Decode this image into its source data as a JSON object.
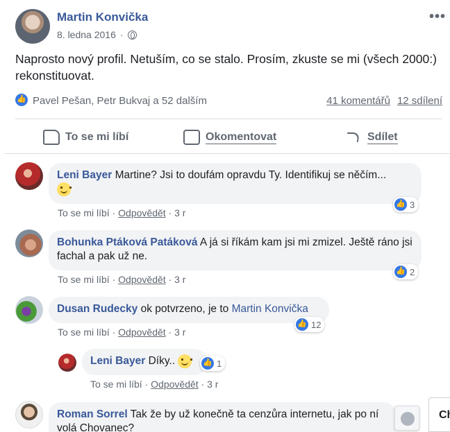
{
  "post": {
    "author": "Martin Konvička",
    "date": "8. ledna 2016",
    "date_separator": "·",
    "privacy_icon": "globe-icon",
    "more_icon": "•••",
    "text": "Naprosto nový profil. Netuším, co se stalo. Prosím, zkuste se mi (všech 2000:) rekonstituovat.",
    "likes_names": "Pavel Pešan, Petr Bukvaj a 52 dalším",
    "comments_count": "41 komentářů",
    "shares_count": "12 sdílení"
  },
  "actions": {
    "like": "To se mi líbí",
    "comment": "Okomentovat",
    "share": "Sdílet"
  },
  "comments": [
    {
      "name": "Leni Bayer",
      "text": "Martine? Jsi to doufám opravdu Ty. Identifikuj se něčím...",
      "like": "To se mi líbí",
      "reply": "Odpovědět",
      "time": "3 r",
      "reactions": "3"
    },
    {
      "name": "Bohunka Ptáková Patáková",
      "text": "A já si říkám kam jsi mi zmizel. Ještě ráno jsi fachal a pak už ne.",
      "like": "To se mi líbí",
      "reply": "Odpovědět",
      "time": "3 r",
      "reactions": "2"
    },
    {
      "name": "Dusan Rudecky",
      "text": "ok potvrzeno, je to",
      "mention": "Martin Konvička",
      "like": "To se mi líbí",
      "reply": "Odpovědět",
      "time": "3 r",
      "reactions": "12"
    },
    {
      "name": "Leni Bayer",
      "text": "Díky..",
      "like": "To se mi líbí",
      "reply": "Odpovědět",
      "time": "3 r",
      "reactions": "1"
    },
    {
      "name": "Roman Sorrel",
      "text": "Tak že by už konečně ta cenzůra internetu, jak po ní volá Chovanec?"
    }
  ],
  "chat_tab_label": "Ch",
  "colors": {
    "link": "#385898",
    "like_blue": "#3578e5",
    "bubble": "#f2f3f5",
    "meta": "#606770"
  }
}
